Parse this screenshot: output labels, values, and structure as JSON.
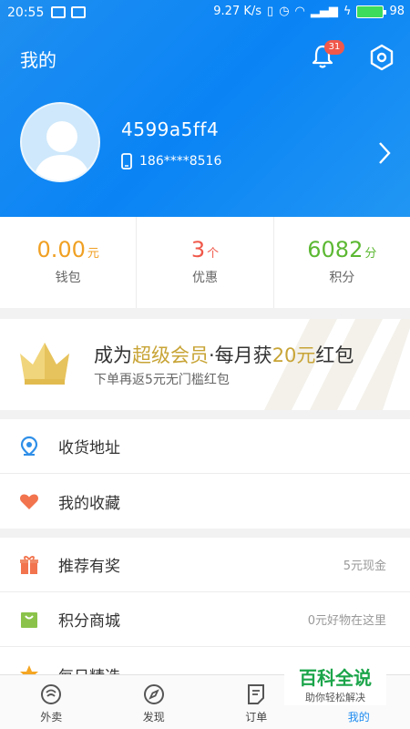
{
  "status_bar": {
    "time": "20:55",
    "speed": "9.27 K/s",
    "battery": "98"
  },
  "header": {
    "title": "我的",
    "notification_count": "31"
  },
  "profile": {
    "username": "4599a5ff4",
    "phone": "186****8516"
  },
  "stats": [
    {
      "value": "0.00",
      "unit": "元",
      "label": "钱包",
      "color": "#f0a023"
    },
    {
      "value": "3",
      "unit": "个",
      "label": "优惠",
      "color": "#f0584a"
    },
    {
      "value": "6082",
      "unit": "分",
      "label": "积分",
      "color": "#5cb833"
    }
  ],
  "banner": {
    "title_prefix": "成为",
    "title_highlight1": "超级会员",
    "title_middle": "·每月获",
    "title_highlight2": "20元",
    "title_suffix": "红包",
    "subtitle": "下单再返5元无门槛红包"
  },
  "menu_group_1": [
    {
      "icon": "location-icon",
      "label": "收货地址"
    },
    {
      "icon": "heart-icon",
      "label": "我的收藏"
    }
  ],
  "menu_group_2": [
    {
      "icon": "gift-icon",
      "label": "推荐有奖",
      "right": "5元现金"
    },
    {
      "icon": "shopping-bag-icon",
      "label": "积分商城",
      "right": "0元好物在这里"
    },
    {
      "icon": "star-icon",
      "label": "每日精选",
      "right": ""
    }
  ],
  "tabs": [
    {
      "icon": "takeout-icon",
      "label": "外卖"
    },
    {
      "icon": "compass-icon",
      "label": "发现"
    },
    {
      "icon": "order-icon",
      "label": "订单"
    },
    {
      "icon": "profile-icon",
      "label": "我的"
    }
  ],
  "watermark": {
    "main": "百科全说",
    "sub": "助你轻松解决"
  },
  "colors": {
    "header_blue": "#1f8ff0",
    "active_tab": "#1b8af0",
    "gold": "#c8a436"
  }
}
